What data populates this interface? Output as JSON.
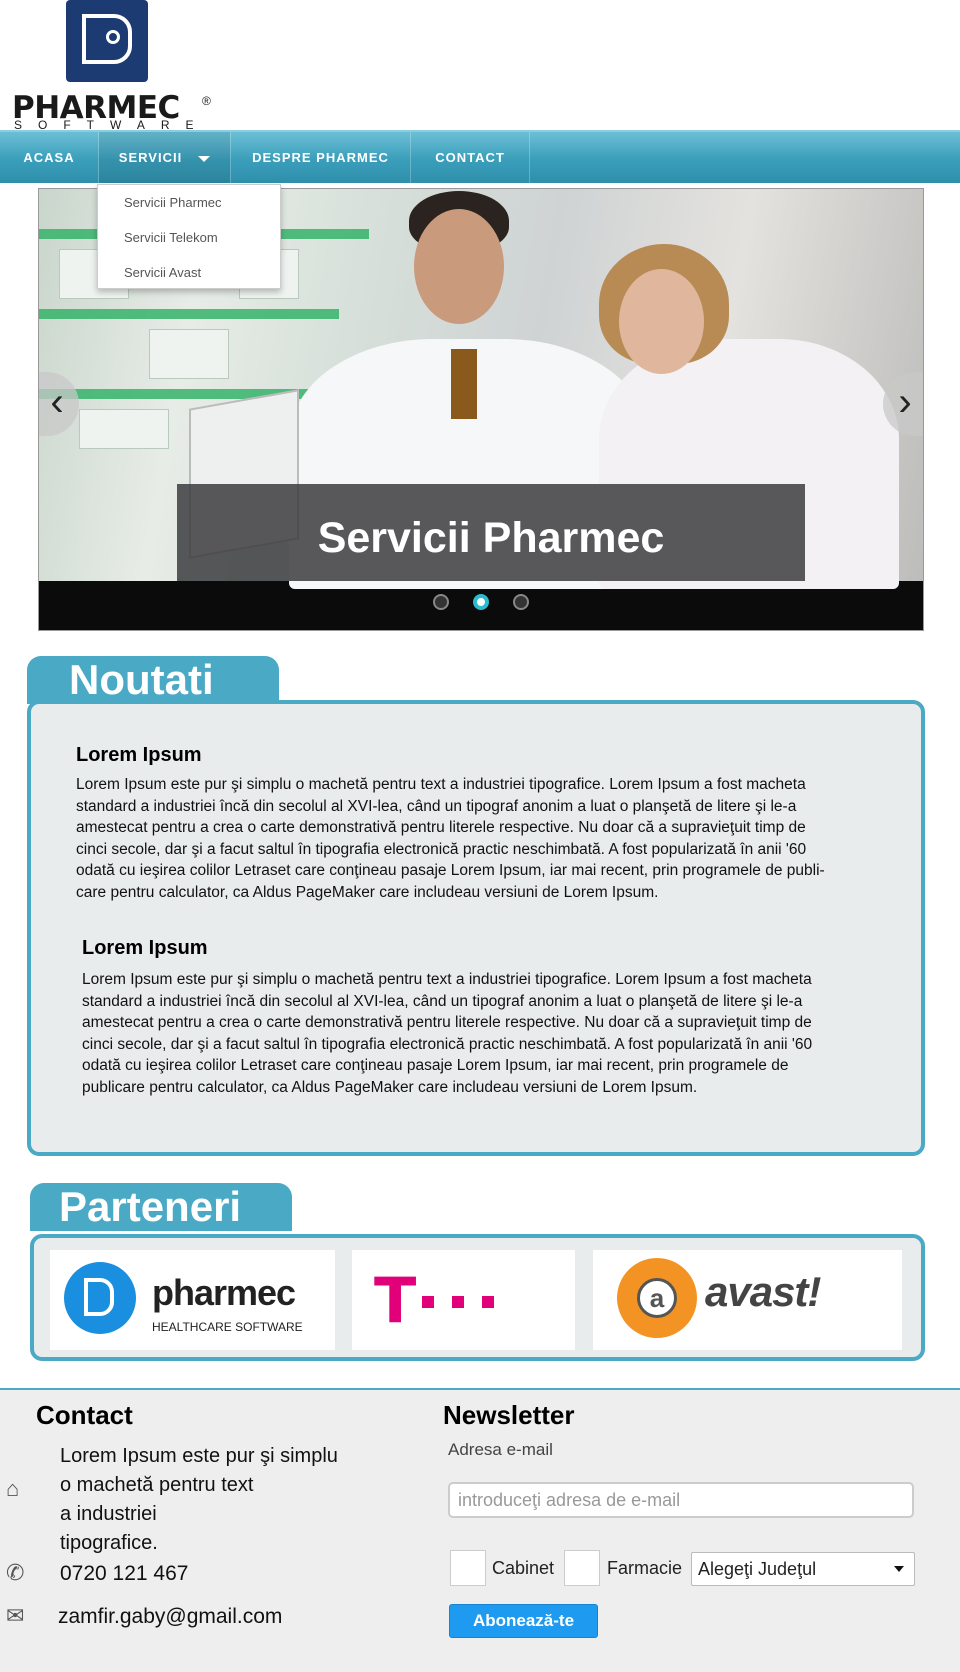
{
  "header": {
    "logo_word": "PHARMEC",
    "logo_reg": "®",
    "logo_sub": "SOFTWARE"
  },
  "nav": {
    "items": [
      {
        "label": "ACASA"
      },
      {
        "label": "SERVICII"
      },
      {
        "label": "DESPRE PHARMEC"
      },
      {
        "label": "CONTACT"
      }
    ],
    "dropdown": [
      "Servicii Pharmec",
      "Servicii Telekom",
      "Servicii Avast"
    ]
  },
  "slider": {
    "caption": "Servicii Pharmec",
    "prev": "‹",
    "next": "›",
    "active_dot": 2,
    "dot_count": 3
  },
  "noutati": {
    "title": "Noutati",
    "articles": [
      {
        "heading": "Lorem Ipsum",
        "lines": [
          "Lorem Ipsum este pur şi simplu o machetă pentru text a industriei tipografice. Lorem Ipsum a fost macheta",
          "standard a industriei încă din secolul al XVI-lea, când un tipograf anonim a luat o planşetă de litere şi le-a",
          "amestecat pentru a crea o carte demonstrativă pentru literele respective. Nu doar că a supravieţuit timp de",
          "cinci secole, dar şi a facut saltul în tipografia electronică practic neschimbată. A fost popularizată în anii '60",
          "odată cu ieşirea colilor Letraset care conţineau pasaje Lorem Ipsum, iar mai recent, prin programele de publi-",
          "care pentru calculator, ca Aldus PageMaker care includeau versiuni de Lorem Ipsum."
        ]
      },
      {
        "heading": "Lorem Ipsum",
        "lines": [
          "Lorem Ipsum este pur şi simplu o machetă pentru text a industriei tipografice. Lorem Ipsum a fost macheta",
          "standard a industriei încă din secolul al XVI-lea, când un tipograf anonim a luat o planşetă de litere şi le-a",
          "amestecat pentru a crea o carte demonstrativă pentru literele respective. Nu doar că a supravieţuit timp de",
          "cinci secole, dar şi a facut saltul în tipografia electronică practic neschimbată. A fost popularizată în anii '60",
          "odată cu ieşirea colilor Letraset care conţineau pasaje Lorem Ipsum, iar mai recent, prin programele de",
          "publicare pentru calculator, ca Aldus PageMaker care includeau versiuni de Lorem Ipsum."
        ]
      }
    ]
  },
  "parteneri": {
    "title": "Parteneri",
    "pharmec_name": "pharmec",
    "pharmec_sub": "HEALTHCARE SOFTWARE",
    "telekom_t": "T",
    "avast_name": "avast!",
    "avast_a": "a"
  },
  "footer": {
    "contact_title": "Contact",
    "contact_lines": [
      "Lorem Ipsum este pur şi simplu",
      "o machetă pentru text",
      "a industriei",
      "tipografice."
    ],
    "phone": "0720 121 467",
    "email": "zamfir.gaby@gmail.com",
    "newsletter_title": "Newsletter",
    "email_label": "Adresa e-mail",
    "email_placeholder": "introduceţi adresa de e-mail",
    "cabinet_label": "Cabinet",
    "farmacie_label": "Farmacie",
    "county_select": "Alegeţi Judeţul",
    "subscribe_button": "Abonează-te"
  },
  "colors": {
    "accent": "#4aa9c5",
    "nav": "#3a9eba",
    "button": "#1e9bf0",
    "telekom": "#e2007a",
    "avast": "#f39323"
  },
  "icons": [
    "home-icon",
    "phone-icon",
    "envelope-icon",
    "chevron-left-icon",
    "chevron-right-icon",
    "caret-down-icon"
  ]
}
